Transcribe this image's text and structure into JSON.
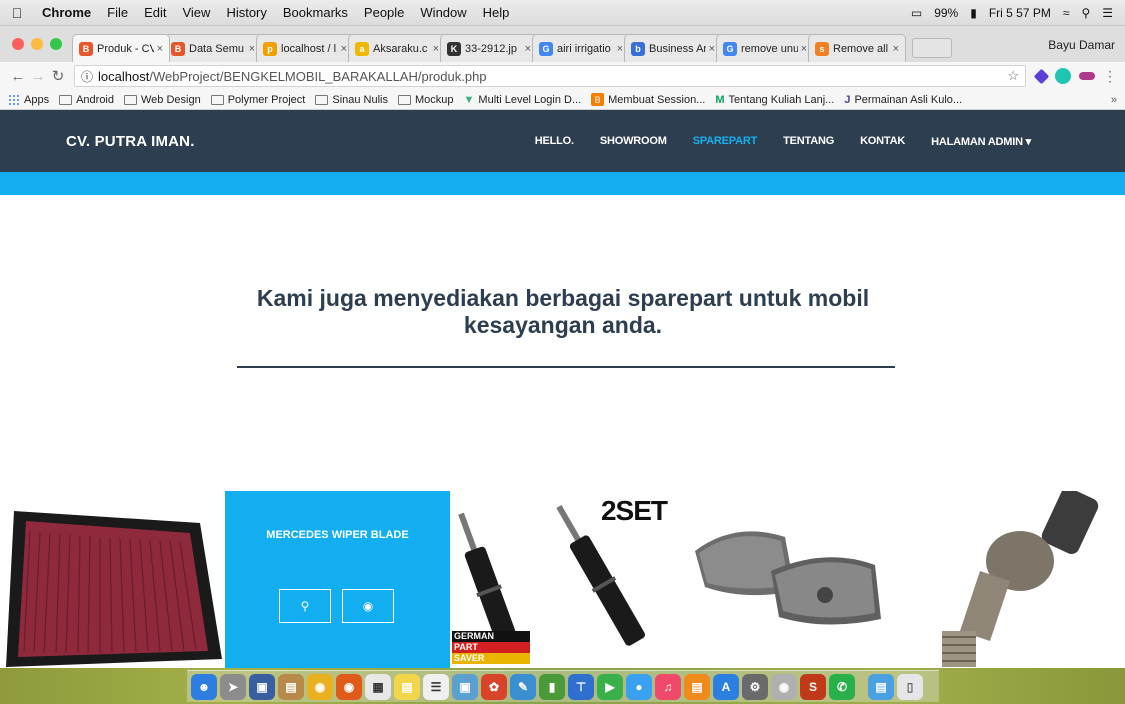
{
  "menubar": {
    "app": "Chrome",
    "items": [
      "File",
      "Edit",
      "View",
      "History",
      "Bookmarks",
      "People",
      "Window",
      "Help"
    ],
    "battery": "99%",
    "clock": "Fri 5 57 PM"
  },
  "tabs": [
    {
      "title": "Produk - CV",
      "color": "#e8572c",
      "glyph": "B",
      "active": true
    },
    {
      "title": "Data Semu",
      "color": "#e8572c",
      "glyph": "B"
    },
    {
      "title": "localhost / l",
      "color": "#f0a000",
      "glyph": "p"
    },
    {
      "title": "Aksaraku.c",
      "color": "#f2b705",
      "glyph": "a"
    },
    {
      "title": "33-2912.jp",
      "color": "#333333",
      "glyph": "K"
    },
    {
      "title": "airi irrigatio",
      "color": "#4285f4",
      "glyph": "G"
    },
    {
      "title": "Business Ar",
      "color": "#3b6fd8",
      "glyph": "b"
    },
    {
      "title": "remove unu",
      "color": "#4285f4",
      "glyph": "G"
    },
    {
      "title": "Remove all",
      "color": "#f48024",
      "glyph": "s"
    }
  ],
  "profile": "Bayu Damar",
  "address": {
    "host": "localhost",
    "path": "/WebProject/BENGKELMOBIL_BARAKALLAH/produk.php"
  },
  "bookmarks": [
    "Apps",
    "Android",
    "Web Design",
    "Polymer Project",
    "Sinau Nulis",
    "Mockup",
    "Multi Level Login D...",
    "Membuat Session...",
    "Tentang Kuliah Lanj...",
    "Permainan Asli Kulo..."
  ],
  "site": {
    "brand": "CV. PUTRA IMAN.",
    "nav": [
      "HELLO.",
      "SHOWROOM",
      "SPAREPART",
      "TENTANG",
      "KONTAK",
      "HALAMAN ADMIN ▾"
    ],
    "active_nav": "SPAREPART",
    "headline": "Kami juga menyediakan berbagai sparepart untuk mobil kesayangan anda.",
    "accent": "#12aef0",
    "navbg": "#2c3e50"
  },
  "products": {
    "hover_caption": "MERCEDES WIPER BLADE",
    "label_2set": "2SET",
    "german_badge": [
      "GERMAN",
      "PART",
      "SAVER"
    ]
  },
  "icons": {
    "search": "search-icon",
    "view": "eye-icon"
  }
}
